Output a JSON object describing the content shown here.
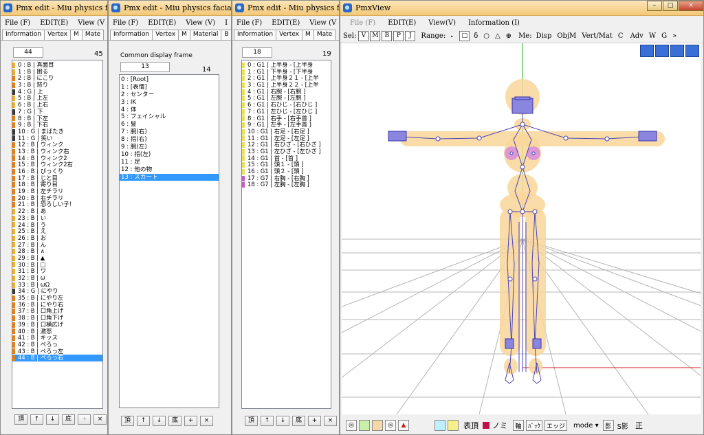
{
  "windows": [
    {
      "title": "Pmx edit - Miu physics facials.pmx",
      "menu": [
        "File (F)",
        "EDIT(E)",
        "View (V"
      ],
      "tabs": [
        "Information",
        "Vertex",
        "M",
        "Mate"
      ],
      "count_input": "44",
      "count_label": "45",
      "items": [
        {
          "text": "0 : B | 真面目",
          "color": "#f0b030"
        },
        {
          "text": "1 : B | 困る",
          "color": "#f0b030"
        },
        {
          "text": "2 : B | にこり",
          "color": "#e88018"
        },
        {
          "text": "3 : B | 怒り",
          "color": "#e88018"
        },
        {
          "text": "4 : G | 上",
          "color": "#3a3a3a"
        },
        {
          "text": "5 : B | 上左",
          "color": "#f0b030"
        },
        {
          "text": "6 : B | 上右",
          "color": "#f0b030"
        },
        {
          "text": "7 : G | 下",
          "color": "#3a3a3a"
        },
        {
          "text": "8 : B | 下左",
          "color": "#e88018"
        },
        {
          "text": "9 : B | 下右",
          "color": "#e88018"
        },
        {
          "text": "10 : G | まばたき",
          "color": "#3a3a3a"
        },
        {
          "text": "11 : G | 笑い",
          "color": "#3a3a3a"
        },
        {
          "text": "12 : B | ウィンク",
          "color": "#e88018"
        },
        {
          "text": "13 : B | ウィンク右",
          "color": "#e88018"
        },
        {
          "text": "14 : B | ウィンク2",
          "color": "#e88018"
        },
        {
          "text": "15 : B | ウィンク2右",
          "color": "#e88018"
        },
        {
          "text": "16 : B | びっくり",
          "color": "#e88018"
        },
        {
          "text": "17 : B | じと目",
          "color": "#e88018"
        },
        {
          "text": "18 : B | 寄り目",
          "color": "#e88018"
        },
        {
          "text": "19 : B | 左チラリ",
          "color": "#e88018"
        },
        {
          "text": "20 : B | 右チラリ",
          "color": "#e88018"
        },
        {
          "text": "21 : B | 恐ろしい子！",
          "color": "#e88018"
        },
        {
          "text": "22 : B | あ",
          "color": "#f0b030"
        },
        {
          "text": "23 : B | い",
          "color": "#f0b030"
        },
        {
          "text": "24 : B | う",
          "color": "#f0b030"
        },
        {
          "text": "25 : B | え",
          "color": "#f0b030"
        },
        {
          "text": "26 : B | お",
          "color": "#f0b030"
        },
        {
          "text": "27 : B | ん",
          "color": "#f0b030"
        },
        {
          "text": "28 : B | ∧",
          "color": "#f0b030"
        },
        {
          "text": "29 : B | ▲",
          "color": "#f0b030"
        },
        {
          "text": "30 : B | □",
          "color": "#f0b030"
        },
        {
          "text": "31 : B | ワ",
          "color": "#f0b030"
        },
        {
          "text": "32 : B | ω",
          "color": "#f0b030"
        },
        {
          "text": "33 : B | ωΩ",
          "color": "#f0b030"
        },
        {
          "text": "34 : G | にやり",
          "color": "#3a3a3a"
        },
        {
          "text": "35 : B | にやり左",
          "color": "#e88018"
        },
        {
          "text": "36 : B | にやり右",
          "color": "#e88018"
        },
        {
          "text": "37 : B | 口角上げ",
          "color": "#e88018"
        },
        {
          "text": "38 : B | 口角下げ",
          "color": "#e88018"
        },
        {
          "text": "39 : B | 口横広げ",
          "color": "#e88018"
        },
        {
          "text": "40 : B | 激怒",
          "color": "#e88018"
        },
        {
          "text": "41 : B | キッス",
          "color": "#e88018"
        },
        {
          "text": "42 : B | ぺろっ",
          "color": "#e88018"
        },
        {
          "text": "43 : B | ぺろっ左",
          "color": "#e88018"
        },
        {
          "text": "44 : B | ぺろっ右",
          "color": "#e88018"
        }
      ],
      "buttons": [
        "頂",
        "↑",
        "↓",
        "底",
        "+",
        "×"
      ]
    },
    {
      "title": "Pmx edit - Miu physics facials.pmx",
      "menu": [
        "File (F)",
        "EDIT(E)",
        "View (V)",
        "I"
      ],
      "tabs": [
        "Information",
        "Vertex",
        "M",
        "Material",
        "B"
      ],
      "section_label": "Common display frame",
      "count_input": "13",
      "count_label": "14",
      "items": [
        "0 : [Root]",
        "1 : [表情]",
        "2 : センター",
        "3 : IK",
        "4 : 体",
        "5 : フェイシャル",
        "6 : 髪",
        "7 : 腕(右)",
        "8 : 指(右)",
        "9 : 腕(左)",
        "10 : 指(左)",
        "11 : 足",
        "12 : 他の物",
        "13 : スカート"
      ],
      "buttons": [
        "頂",
        "↑",
        "↓",
        "底",
        "+",
        "×"
      ]
    },
    {
      "title": "Pmx edit - Miu physics facials.pmx",
      "menu": [
        "File (F)",
        "EDIT(E)",
        "View (V"
      ],
      "tabs": [
        "Information",
        "Vertex",
        "M",
        "Mate"
      ],
      "count_input": "18",
      "count_label": "19",
      "items": [
        {
          "text": "0 : G1 | 上半身 - [上半身",
          "color": "#e8e060"
        },
        {
          "text": "1 : G1 | 下半身 - [下半身",
          "color": "#e8e060"
        },
        {
          "text": "2 : G1 | 上半身２１ - [上半",
          "color": "#e8e060"
        },
        {
          "text": "3 : G1 | 上半身２２ - [上半",
          "color": "#e8e060"
        },
        {
          "text": "4 : G1 | 右腕 - [右腕 ]",
          "color": "#e8e060"
        },
        {
          "text": "5 : G1 | 左腕 - [左腕 ]",
          "color": "#e8e060"
        },
        {
          "text": "6 : G1 | 右ひじ - [右ひじ ]",
          "color": "#e8e060"
        },
        {
          "text": "7 : G1 | 左ひじ - [左ひじ ]",
          "color": "#e8e060"
        },
        {
          "text": "8 : G1 | 右手 - [右手首 ]",
          "color": "#e8e060"
        },
        {
          "text": "9 : G1 | 左手 - [左手首 ]",
          "color": "#e8e060"
        },
        {
          "text": "10 : G1 | 右足 - [右足 ]",
          "color": "#e8e060"
        },
        {
          "text": "11 : G1 | 左足 - [左足 ]",
          "color": "#e8e060"
        },
        {
          "text": "12 : G1 | 右ひざ - [右ひざ ]",
          "color": "#e8e060"
        },
        {
          "text": "13 : G1 | 左ひざ - [左ひざ ]",
          "color": "#e8e060"
        },
        {
          "text": "14 : G1 | 首 - [首 ]",
          "color": "#e8e060"
        },
        {
          "text": "15 : G1 | 頭１ - [頭 ]",
          "color": "#e8e060"
        },
        {
          "text": "16 : G1 | 頭２ - [頭 ]",
          "color": "#e8e060"
        },
        {
          "text": "17 : G7 | 右胸 - [右胸 ]",
          "color": "#c060c0"
        },
        {
          "text": "18 : G7 | 左胸 - [左胸 ]",
          "color": "#c060c0"
        }
      ],
      "buttons": [
        "頂",
        "↑",
        "↓",
        "底",
        "+",
        "×"
      ]
    }
  ],
  "pmxview": {
    "title": "PmxView",
    "menu": [
      "File (F)",
      "EDIT(E)",
      "View(V)",
      "Information (I)"
    ],
    "sel_label": "Sel:",
    "sel_buttons": [
      "V",
      "M",
      "B",
      "P",
      "J"
    ],
    "range_label": "Range:",
    "range_buttons": [
      "・",
      "□",
      "δ",
      "○",
      "△",
      "⊕"
    ],
    "me_label": "Me:",
    "tools": [
      "Disp",
      "ObjM",
      "Vert/Mat",
      "C",
      "Adv",
      "W",
      "G",
      "»"
    ],
    "bottom_labels": [
      "表頂",
      "ノミ",
      "軸",
      "ﾊﾞｯｸ",
      "エッジ",
      "mode ▾",
      "影",
      "S影",
      "正"
    ],
    "window_controls": [
      "–",
      "□",
      "×"
    ]
  }
}
